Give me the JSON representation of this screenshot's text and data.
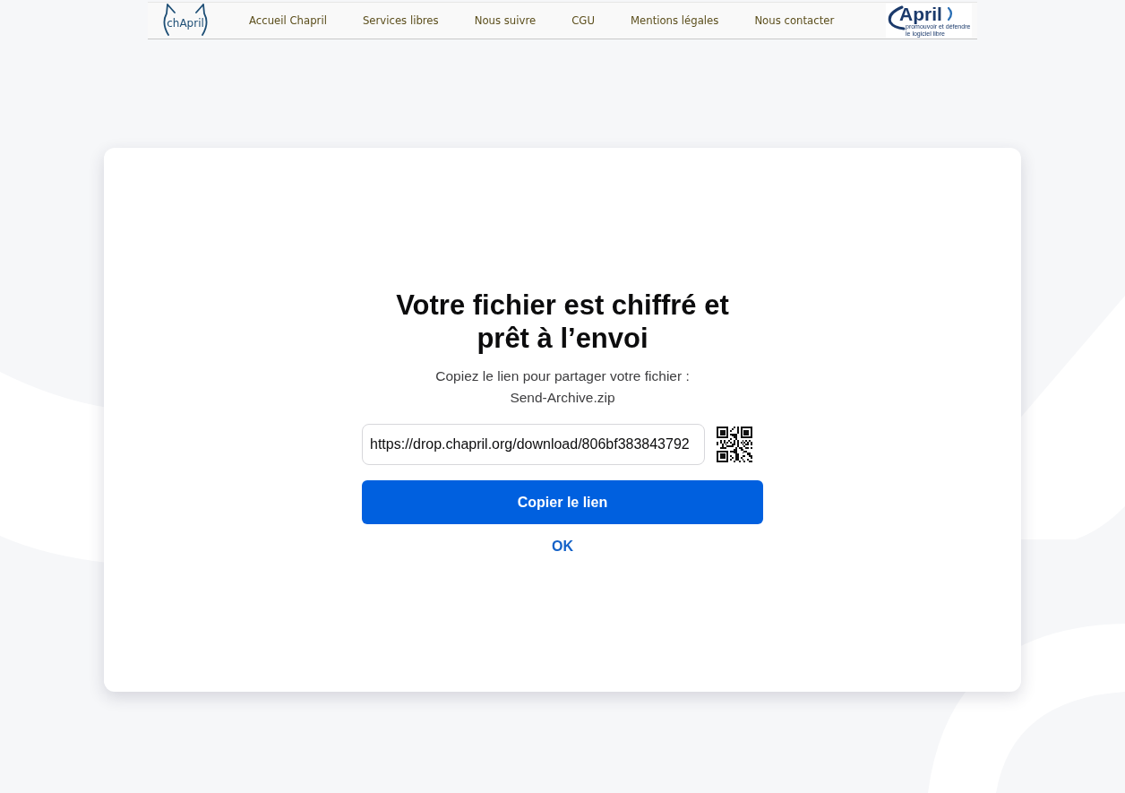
{
  "nav": {
    "logo_left": "chApril",
    "items": [
      "Accueil Chapril",
      "Services libres",
      "Nous suivre",
      "CGU",
      "Mentions légales",
      "Nous contacter"
    ],
    "logo_right": {
      "name": "April",
      "tagline_lines": [
        "promouvoir et défendre",
        "le logiciel libre"
      ]
    }
  },
  "card": {
    "title": "Votre fichier est chiffré et prêt à l’envoi",
    "message": "Copiez le lien pour partager votre fichier :",
    "file_name": "Send-Archive.zip",
    "link_field": {
      "value": "https://drop.chapril.org/download/806bf383843792"
    },
    "copy_button": "Copier le lien",
    "ok_link": "OK"
  }
}
